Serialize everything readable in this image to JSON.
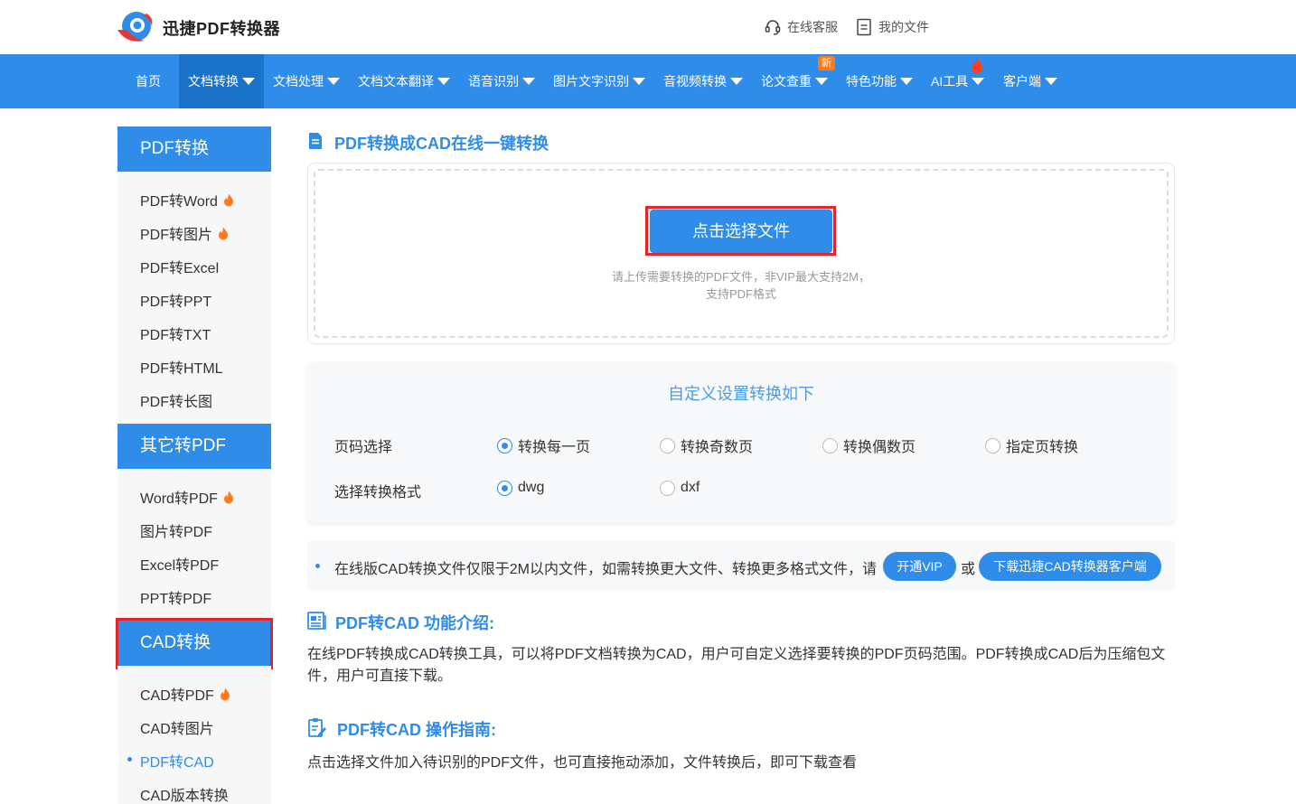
{
  "header": {
    "logo_text": "迅捷PDF转换器",
    "links": [
      {
        "label": "在线客服",
        "icon": "headset-icon"
      },
      {
        "label": "我的文件",
        "icon": "file-icon"
      }
    ]
  },
  "nav": {
    "items": [
      {
        "label": "首页"
      },
      {
        "label": "文档转换"
      },
      {
        "label": "文档处理"
      },
      {
        "label": "文档文本翻译"
      },
      {
        "label": "语音识别"
      },
      {
        "label": "图片文字识别"
      },
      {
        "label": "音视频转换"
      },
      {
        "label": "论文查重"
      },
      {
        "label": "特色功能"
      },
      {
        "label": "AI工具"
      },
      {
        "label": "客户端"
      }
    ],
    "new_badge": "新"
  },
  "sidebar": {
    "groups": [
      {
        "title": "PDF转换",
        "items": [
          "PDF转Word",
          "PDF转图片",
          "PDF转Excel",
          "PDF转PPT",
          "PDF转TXT",
          "PDF转HTML",
          "PDF转长图"
        ]
      },
      {
        "title": "其它转PDF",
        "items": [
          "Word转PDF",
          "图片转PDF",
          "Excel转PDF",
          "PPT转PDF"
        ]
      },
      {
        "title": "CAD转换",
        "items": [
          "CAD转PDF",
          "CAD转图片",
          "PDF转CAD",
          "CAD版本转换"
        ]
      }
    ],
    "current_item": "PDF转CAD"
  },
  "main": {
    "title": "PDF转换成CAD在线一键转换",
    "upload": {
      "button_label": "点击选择文件",
      "hint_line1": "请上传需要转换的PDF文件，非VIP最大支持2M，",
      "hint_line2": "支持PDF格式"
    },
    "settings": {
      "title": "自定义设置转换如下",
      "page_label": "页码选择",
      "page_options": [
        "转换每一页",
        "转换奇数页",
        "转换偶数页",
        "指定页转换"
      ],
      "page_selected": "转换每一页",
      "format_label": "选择转换格式",
      "format_options": [
        "dwg",
        "dxf"
      ],
      "format_selected": "dwg"
    },
    "notice": {
      "text": "在线版CAD转换文件仅限于2M以内文件，如需转换更大文件、转换更多格式文件，请",
      "vip_button": "开通VIP",
      "or_text": "或",
      "download_button": "下载迅捷CAD转换器客户端"
    },
    "intro": {
      "title": "PDF转CAD 功能介绍:",
      "text": "在线PDF转换成CAD转换工具，可以将PDF文档转换为CAD，用户可自定义选择要转换的PDF页码范围。PDF转换成CAD后为压缩包文件，用户可直接下载。"
    },
    "guide": {
      "title": "PDF转CAD 操作指南:",
      "text": "点击选择文件加入待识别的PDF文件，也可直接拖动添加，文件转换后，即可下载查看"
    }
  },
  "colors": {
    "brand_blue": "#2f8ce8",
    "active_nav": "#1a72c9",
    "highlight_red": "#e0262a",
    "flame_orange": "#ff7a1a"
  }
}
